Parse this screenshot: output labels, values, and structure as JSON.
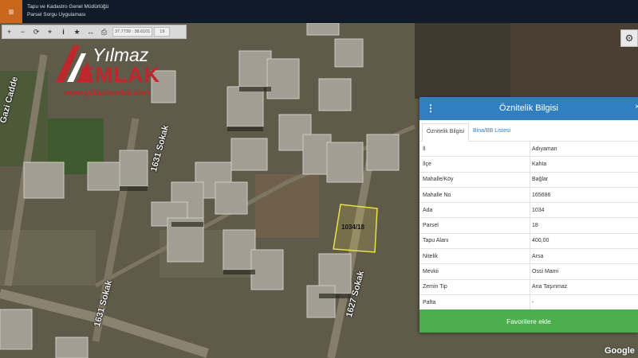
{
  "header": {
    "org_name": "Tapu ve Kadastro Genel Müdürlüğü",
    "app_name": "Parsel Sorgu Uygulaması",
    "menu_icon": "hamburger-icon"
  },
  "toolbar": {
    "tools": [
      {
        "name": "zoom-in-icon",
        "glyph": "+"
      },
      {
        "name": "zoom-out-icon",
        "glyph": "−"
      },
      {
        "name": "refresh-icon",
        "glyph": "⟳"
      },
      {
        "name": "locate-icon",
        "glyph": "⌖"
      },
      {
        "name": "info-icon",
        "glyph": "i"
      },
      {
        "name": "star-icon",
        "glyph": "★"
      },
      {
        "name": "measure-icon",
        "glyph": "↔"
      },
      {
        "name": "print-icon",
        "glyph": "⎙"
      }
    ],
    "coordinates": "37.7739 : 38.6101",
    "zoom_level": "19"
  },
  "map": {
    "street_labels": [
      "Gazi Cadde",
      "1631 Sokak",
      "1631 Sokak",
      "1627 Sokak"
    ],
    "parcel_label": "1034/18",
    "settings_icon": "gear-icon",
    "attribution": "Google"
  },
  "watermark": {
    "brand_top": "Yılmaz",
    "brand_main": "EMLAK",
    "url": "www.yilmazemlak.com"
  },
  "panel": {
    "title": "Öznitelik Bilgisi",
    "tabs": [
      "Öznitelik Bilgisi",
      "Bina/BB Listesi"
    ],
    "rows": [
      {
        "key": "İl",
        "value": "Adıyaman"
      },
      {
        "key": "İlçe",
        "value": "Kahta"
      },
      {
        "key": "Mahalle/Köy",
        "value": "Bağlar"
      },
      {
        "key": "Mahalle No",
        "value": "165686"
      },
      {
        "key": "Ada",
        "value": "1034"
      },
      {
        "key": "Parsel",
        "value": "18"
      },
      {
        "key": "Tapu Alanı",
        "value": "400,00"
      },
      {
        "key": "Nitelik",
        "value": "Arsa"
      },
      {
        "key": "Mevkii",
        "value": "Ossi Mami"
      },
      {
        "key": "Zemin Tip",
        "value": "Ana Taşınmaz"
      },
      {
        "key": "Pafta",
        "value": "-"
      }
    ],
    "favorite_button": "Favorilere ekle"
  },
  "colors": {
    "header_bg": "#0f1b29",
    "menu_accent": "#c8671d",
    "panel_header": "#2f7fc1",
    "favorite_button": "#4cae4c",
    "parcel_outline": "#e8e24a",
    "logo_red": "#c0262b"
  }
}
